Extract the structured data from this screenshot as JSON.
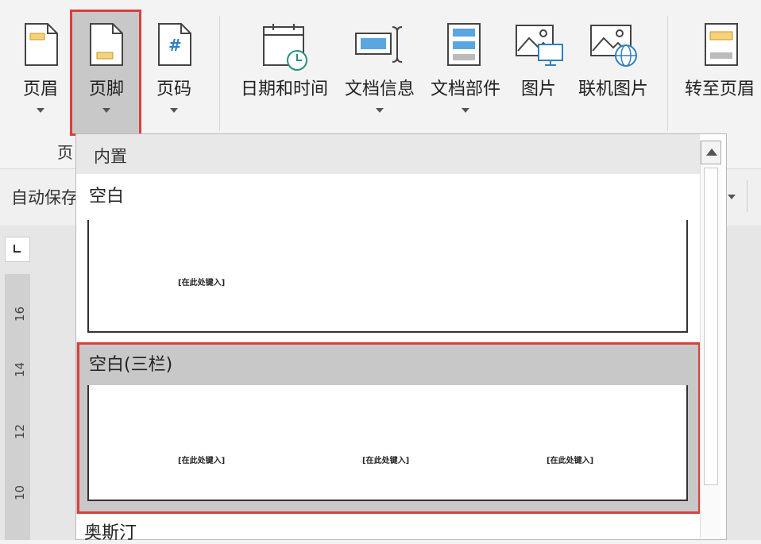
{
  "ribbon": {
    "buttons": [
      {
        "label": "页眉",
        "icon": "page-header-icon",
        "has_dropdown": true
      },
      {
        "label": "页脚",
        "icon": "page-footer-icon",
        "has_dropdown": true,
        "selected": true
      },
      {
        "label": "页码",
        "icon": "page-number-icon",
        "has_dropdown": true
      },
      {
        "label": "日期和时间",
        "icon": "calendar-clock-icon",
        "has_dropdown": false
      },
      {
        "label": "文档信息",
        "icon": "document-info-icon",
        "has_dropdown": true
      },
      {
        "label": "文档部件",
        "icon": "document-parts-icon",
        "has_dropdown": true
      },
      {
        "label": "图片",
        "icon": "picture-icon",
        "has_dropdown": false
      },
      {
        "label": "联机图片",
        "icon": "online-picture-icon",
        "has_dropdown": false
      },
      {
        "label": "转至页眉",
        "icon": "goto-header-icon",
        "has_dropdown": false
      }
    ],
    "group_label_partial": "页"
  },
  "toolbar2": {
    "autosave_partial": "自动保存"
  },
  "dropdown": {
    "section_header": "内置",
    "items": [
      {
        "title": "空白",
        "placeholders": [
          "[在此处键入]"
        ]
      },
      {
        "title": "空白(三栏)",
        "placeholders": [
          "[在此处键入]",
          "[在此处键入]",
          "[在此处键入]"
        ],
        "highlighted": true
      },
      {
        "title": "奥斯汀"
      }
    ]
  },
  "ruler": {
    "ticks": [
      "16",
      "14",
      "12",
      "10"
    ]
  },
  "colors": {
    "highlight_border": "#d9403b",
    "selected_bg": "#c8c8c8",
    "icon_blue": "#2f7fc1",
    "icon_yellow": "#f5d27a"
  }
}
